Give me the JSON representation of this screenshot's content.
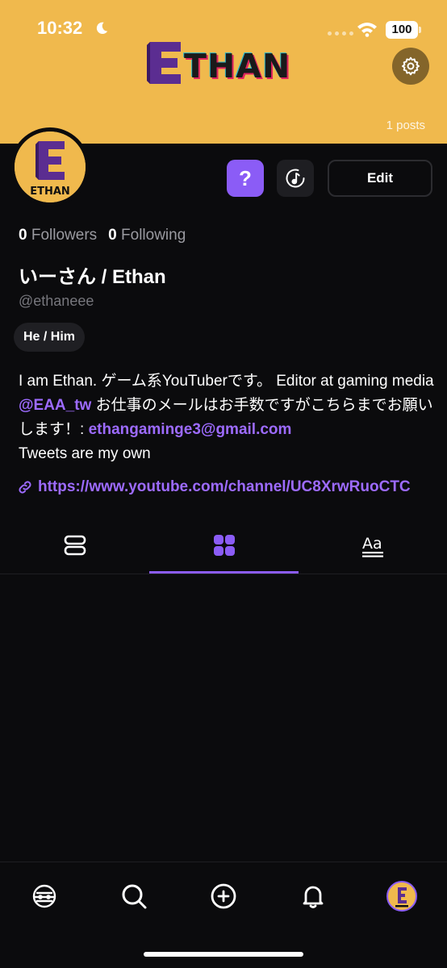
{
  "status_bar": {
    "time": "10:32",
    "battery": "100"
  },
  "banner": {
    "logo_text": "ETHAN",
    "posts": "1 posts"
  },
  "avatar": {
    "label": "ETHAN"
  },
  "actions": {
    "question": "?",
    "edit": "Edit"
  },
  "stats": {
    "followers_count": "0",
    "followers_label": "Followers",
    "following_count": "0",
    "following_label": "Following"
  },
  "profile": {
    "name": "いーさん / Ethan",
    "handle": "@ethaneee",
    "pronouns": "He / Him",
    "bio_part1": "I am Ethan. ゲーム系YouTuberです。 Editor at gaming media ",
    "bio_mention": "@EAA_tw",
    "bio_part2": " お仕事のメールはお手数ですがこちらまでお願いします！: ",
    "bio_email": "ethangaminge3@gmail.com",
    "bio_part3": "Tweets are my own",
    "url": "https://www.youtube.com/channel/UC8XrwRuoCTC"
  },
  "tabs": [
    {
      "icon": "list-view-icon",
      "active": false
    },
    {
      "icon": "grid-view-icon",
      "active": true
    },
    {
      "icon": "text-view-icon",
      "active": false
    }
  ],
  "bottom_nav": [
    {
      "icon": "home-icon"
    },
    {
      "icon": "search-icon"
    },
    {
      "icon": "create-post-icon"
    },
    {
      "icon": "notifications-icon"
    },
    {
      "icon": "profile-avatar-icon"
    }
  ],
  "colors": {
    "banner": "#f0b94d",
    "accent": "#8b5cf6",
    "link": "#9d6bff",
    "background": "#0b0b0d"
  }
}
